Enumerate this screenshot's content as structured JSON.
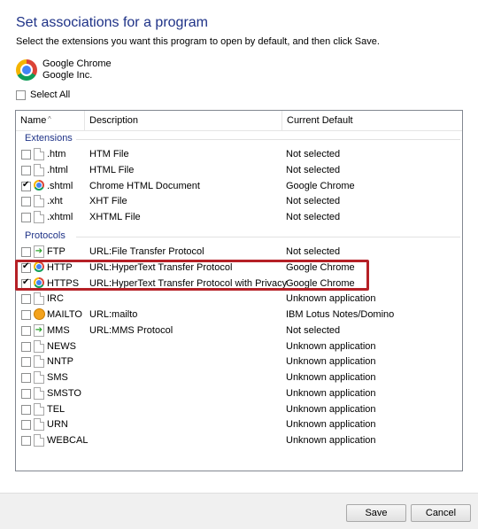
{
  "dialog": {
    "title": "Set associations for a program",
    "subtitle": "Select the extensions you want this program to open by default, and then click Save.",
    "app_name": "Google Chrome",
    "app_publisher": "Google Inc.",
    "select_all_label": "Select All"
  },
  "columns": {
    "name": "Name",
    "description": "Description",
    "current_default": "Current Default"
  },
  "groups": {
    "extensions": "Extensions",
    "protocols": "Protocols"
  },
  "extensions": [
    {
      "name": ".htm",
      "description": "HTM File",
      "current_default": "Not selected",
      "checked": false,
      "icon": "file-icon"
    },
    {
      "name": ".html",
      "description": "HTML File",
      "current_default": "Not selected",
      "checked": false,
      "icon": "file-icon"
    },
    {
      "name": ".shtml",
      "description": "Chrome HTML Document",
      "current_default": "Google Chrome",
      "checked": true,
      "icon": "chrome-icon"
    },
    {
      "name": ".xht",
      "description": "XHT File",
      "current_default": "Not selected",
      "checked": false,
      "icon": "file-icon"
    },
    {
      "name": ".xhtml",
      "description": "XHTML File",
      "current_default": "Not selected",
      "checked": false,
      "icon": "file-icon"
    }
  ],
  "protocols": [
    {
      "name": "FTP",
      "description": "URL:File Transfer Protocol",
      "current_default": "Not selected",
      "checked": false,
      "icon": "arrow-icon"
    },
    {
      "name": "HTTP",
      "description": "URL:HyperText Transfer Protocol",
      "current_default": "Google Chrome",
      "checked": true,
      "icon": "chrome-icon"
    },
    {
      "name": "HTTPS",
      "description": "URL:HyperText Transfer Protocol with Privacy",
      "current_default": "Google Chrome",
      "checked": true,
      "icon": "chrome-icon"
    },
    {
      "name": "IRC",
      "description": "",
      "current_default": "Unknown application",
      "checked": false,
      "icon": "file-icon"
    },
    {
      "name": "MAILTO",
      "description": "URL:mailto",
      "current_default": "IBM Lotus Notes/Domino",
      "checked": false,
      "icon": "mail-icon"
    },
    {
      "name": "MMS",
      "description": "URL:MMS Protocol",
      "current_default": "Not selected",
      "checked": false,
      "icon": "arrow-icon"
    },
    {
      "name": "NEWS",
      "description": "",
      "current_default": "Unknown application",
      "checked": false,
      "icon": "file-icon"
    },
    {
      "name": "NNTP",
      "description": "",
      "current_default": "Unknown application",
      "checked": false,
      "icon": "file-icon"
    },
    {
      "name": "SMS",
      "description": "",
      "current_default": "Unknown application",
      "checked": false,
      "icon": "file-icon"
    },
    {
      "name": "SMSTO",
      "description": "",
      "current_default": "Unknown application",
      "checked": false,
      "icon": "file-icon"
    },
    {
      "name": "TEL",
      "description": "",
      "current_default": "Unknown application",
      "checked": false,
      "icon": "file-icon"
    },
    {
      "name": "URN",
      "description": "",
      "current_default": "Unknown application",
      "checked": false,
      "icon": "file-icon"
    },
    {
      "name": "WEBCAL",
      "description": "",
      "current_default": "Unknown application",
      "checked": false,
      "icon": "file-icon"
    }
  ],
  "buttons": {
    "save": "Save",
    "cancel": "Cancel"
  },
  "colors": {
    "title": "#1e3287",
    "highlight_border": "#b52026"
  }
}
